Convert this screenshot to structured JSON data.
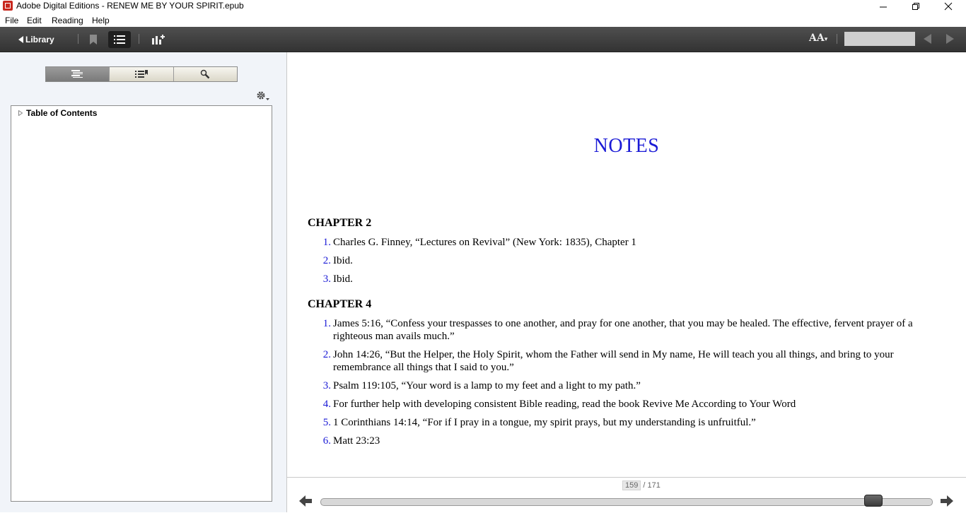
{
  "window": {
    "title": "Adobe Digital Editions - RENEW ME BY YOUR SPIRIT.epub"
  },
  "menu": {
    "items": [
      {
        "label": "File"
      },
      {
        "label": "Edit"
      },
      {
        "label": "Reading"
      },
      {
        "label": "Help"
      }
    ]
  },
  "toolbar": {
    "library_label": "Library",
    "font_size_label": "AA",
    "page_search_value": ""
  },
  "sidebar": {
    "toc_label": "Table of Contents"
  },
  "book": {
    "page_title": "NOTES",
    "chapters": [
      {
        "heading": "CHAPTER 2",
        "notes": [
          {
            "num": "1.",
            "text": "Charles G. Finney, “Lectures on Revival” (New York: 1835), Chapter 1"
          },
          {
            "num": "2.",
            "text": "Ibid."
          },
          {
            "num": "3.",
            "text": "Ibid."
          }
        ]
      },
      {
        "heading": "CHAPTER 4",
        "notes": [
          {
            "num": "1.",
            "text": "James 5:16, “Confess your trespasses to one another, and pray for one another, that you may be healed. The effective, fervent prayer of a righteous man avails much.”"
          },
          {
            "num": "2.",
            "text": "John 14:26, “But the Helper, the Holy Spirit, whom the Father will send in My name, He will teach you all things, and bring to your remembrance all things that I said to you.”"
          },
          {
            "num": "3.",
            "text": "Psalm 119:105, “Your word is a lamp to my feet and a light to my path.”"
          },
          {
            "num": "4.",
            "text": "For further help with developing consistent Bible reading, read the book Revive Me According to Your Word"
          },
          {
            "num": "5.",
            "text": "1 Corinthians 14:14, “For if I pray in a tongue, my spirit prays, but my understanding is unfruitful.”"
          },
          {
            "num": "6.",
            "text": "Matt 23:23"
          }
        ]
      }
    ]
  },
  "pagination": {
    "current": "159",
    "total": "/ 171",
    "progress": 0.915
  },
  "colors": {
    "title_blue": "#1a1ad6",
    "toolbar_bg": "#3f3f3f",
    "sidebar_bg": "#f1f4f9"
  }
}
